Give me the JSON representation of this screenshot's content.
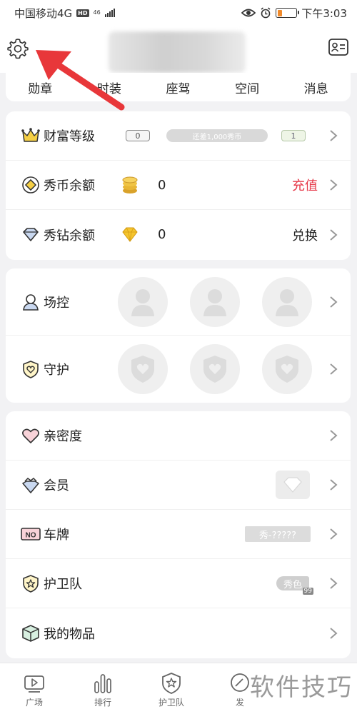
{
  "status_bar": {
    "carrier": "中国移动4G",
    "hd": "HD",
    "net": "46",
    "time": "下午3:03"
  },
  "tabs": [
    "勋章",
    "时装",
    "座驾",
    "空间",
    "消息"
  ],
  "wealth": {
    "label": "财富等级",
    "current_level": "0",
    "progress_text": "还差1,000秀币",
    "next_level": "1"
  },
  "coins": {
    "label": "秀币余额",
    "value": "0",
    "action": "充值"
  },
  "diamonds": {
    "label": "秀钻余额",
    "value": "0",
    "action": "兑换"
  },
  "venue_control": {
    "label": "场控"
  },
  "guard": {
    "label": "守护"
  },
  "list": {
    "intimacy": "亲密度",
    "member": "会员",
    "plate": "车牌",
    "plate_value": "秀-?????",
    "guard_team": "护卫队",
    "guard_team_badge": "秀色",
    "guard_team_level": "99",
    "items": "我的物品"
  },
  "bottom_nav": {
    "plaza": "广场",
    "rank": "排行",
    "guard_team": "护卫队",
    "publish": "发"
  },
  "watermark": "软件技巧",
  "colors": {
    "accent_red": "#e63a4a",
    "annotation_red": "#e8373a",
    "gold": "#f2c230"
  }
}
